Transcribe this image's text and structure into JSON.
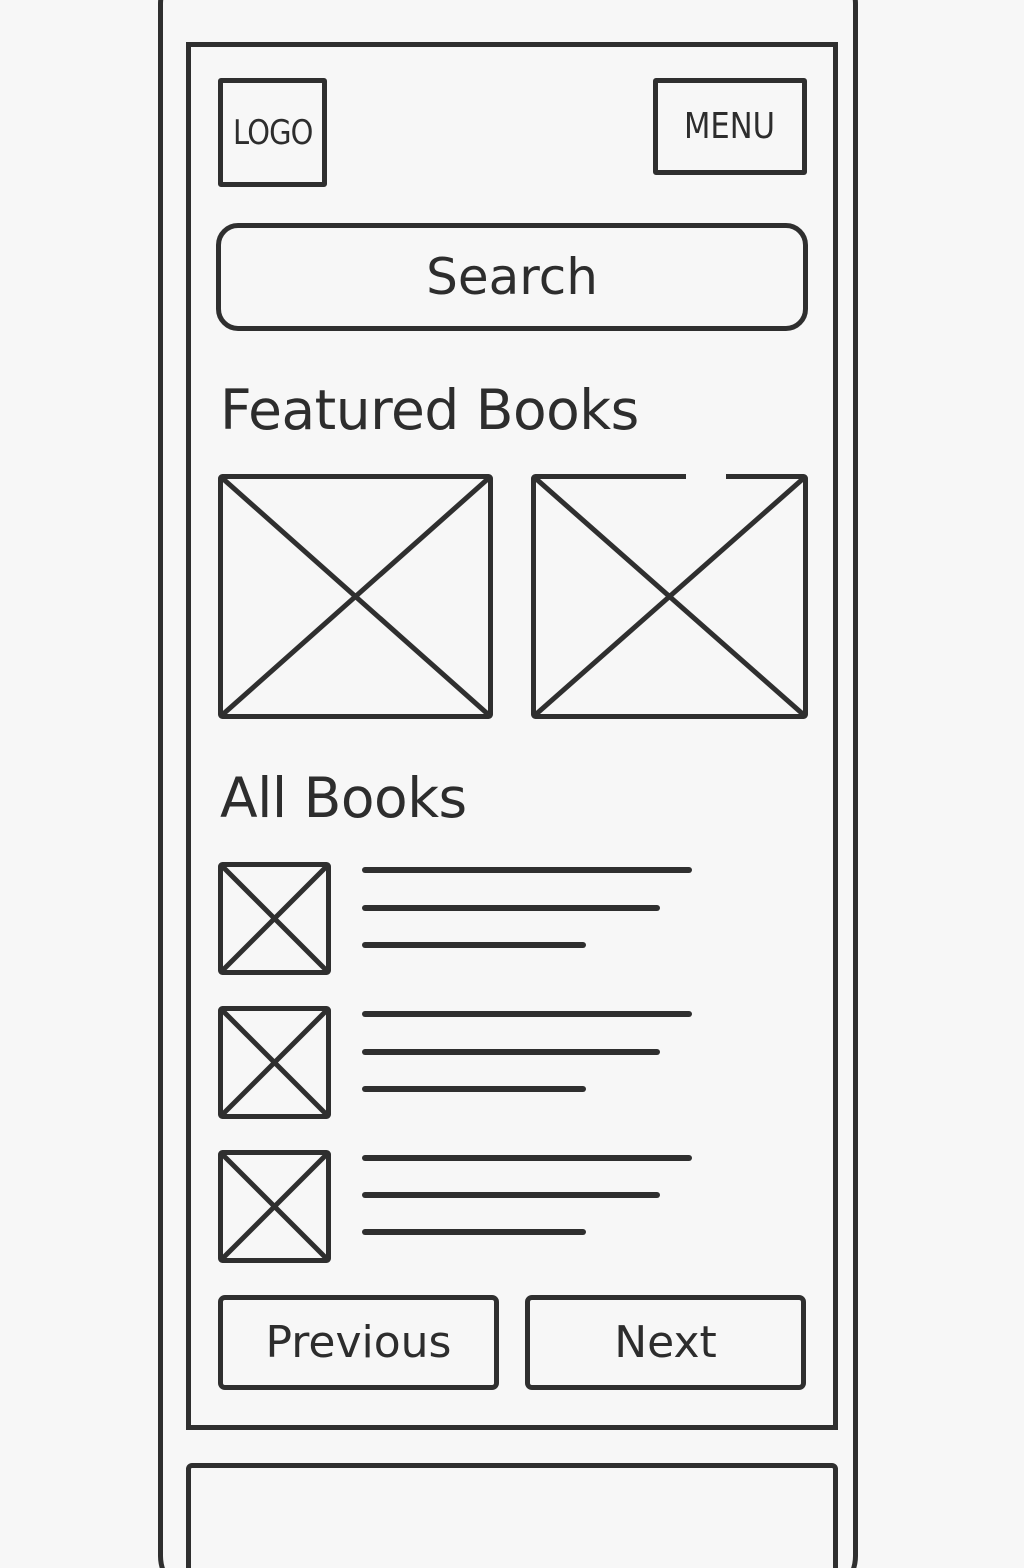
{
  "header": {
    "logo_text": "LOGO",
    "menu_label": "MENU"
  },
  "search": {
    "label": "Search"
  },
  "featured": {
    "heading": "Featured Books",
    "items": [
      {
        "image": "image-placeholder"
      },
      {
        "image": "image-placeholder"
      }
    ]
  },
  "all_books": {
    "heading": "All Books",
    "items": [
      {
        "thumbnail": "image-placeholder",
        "text_lines": 3
      },
      {
        "thumbnail": "image-placeholder",
        "text_lines": 3
      },
      {
        "thumbnail": "image-placeholder",
        "text_lines": 3
      }
    ]
  },
  "pagination": {
    "previous_label": "Previous",
    "next_label": "Next"
  },
  "colors": {
    "stroke": "#2f2f2f",
    "background": "#f7f7f7"
  }
}
